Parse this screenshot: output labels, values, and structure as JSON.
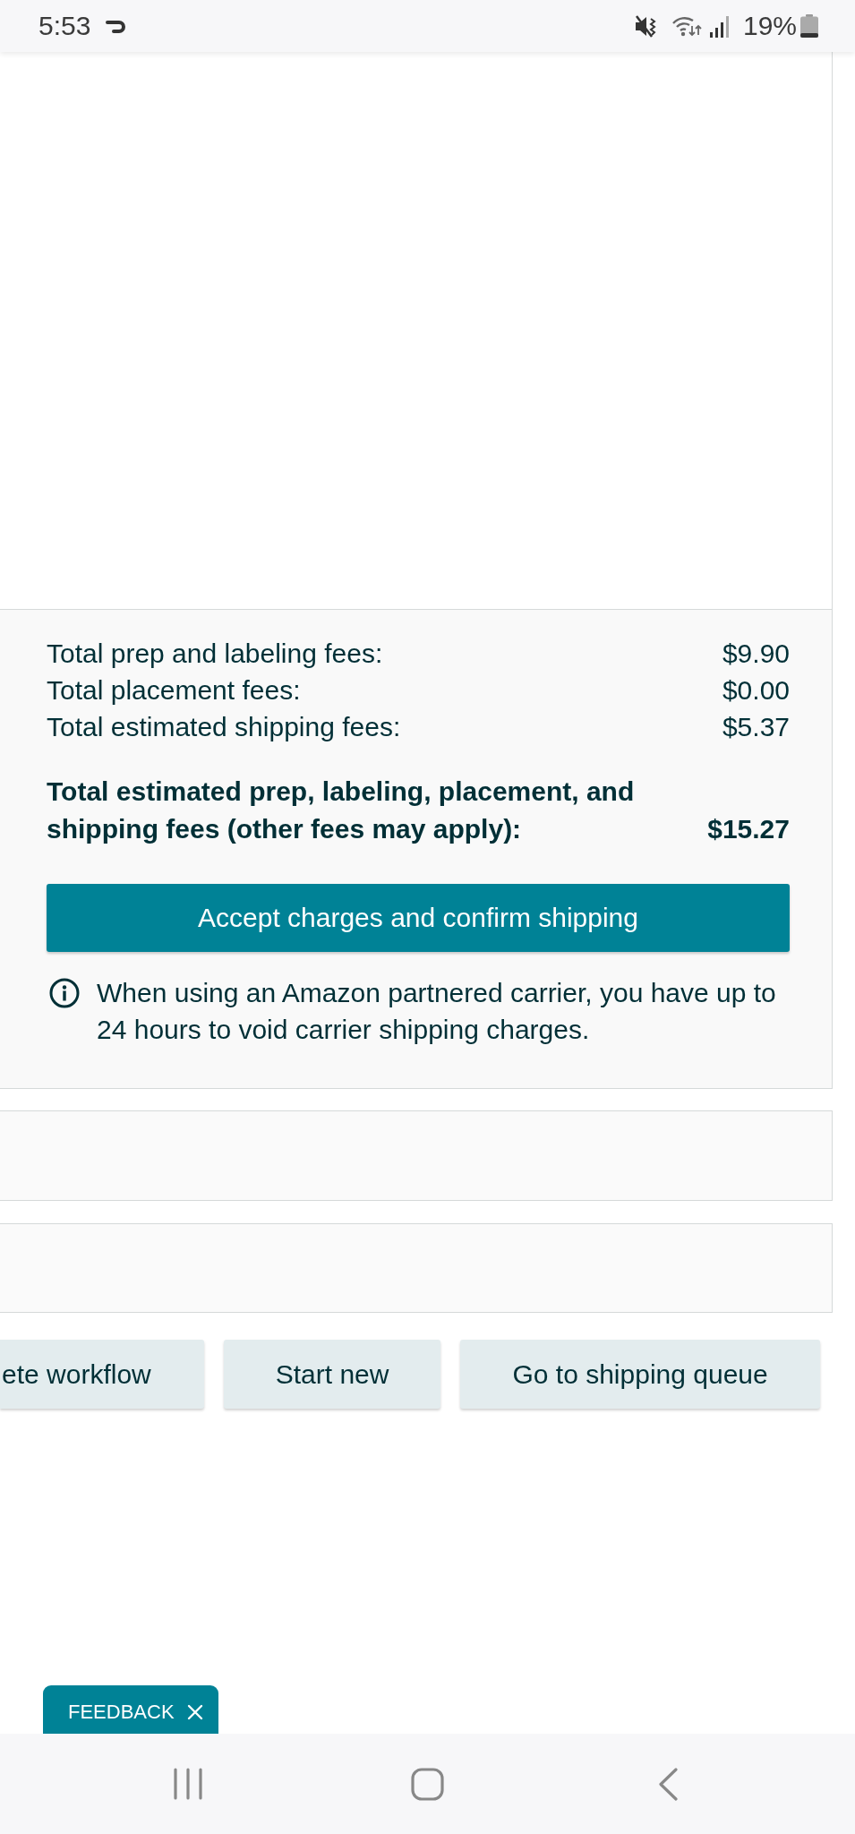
{
  "status_bar": {
    "time": "5:53",
    "battery": "19%"
  },
  "fees": {
    "rows": [
      {
        "label": "Total prep and labeling fees:",
        "amount": "$9.90"
      },
      {
        "label": "Total placement fees:",
        "amount": "$0.00"
      },
      {
        "label": "Total estimated shipping fees:",
        "amount": "$5.37"
      }
    ],
    "total": {
      "label": "Total estimated prep, labeling, placement, and shipping fees (other fees may apply):",
      "amount": "$15.27"
    }
  },
  "confirm_button": {
    "label": "Accept charges and confirm shipping"
  },
  "info_note": "When using an Amazon partnered carrier, you have up to 24 hours to void carrier shipping charges.",
  "action_buttons": [
    {
      "label": "ete workflow"
    },
    {
      "label": "Start new"
    },
    {
      "label": "Go to shipping queue"
    }
  ],
  "feedback_tab": {
    "label": "FEEDBACK"
  }
}
